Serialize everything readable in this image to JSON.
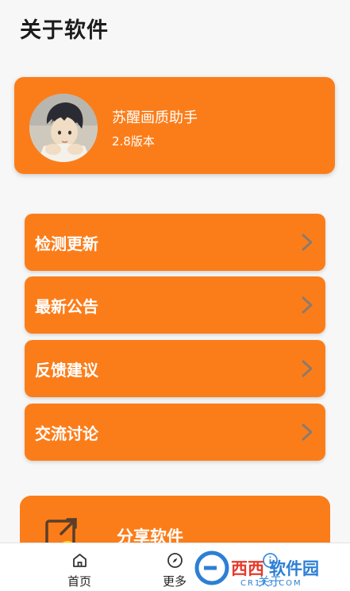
{
  "header": {
    "title": "关于软件"
  },
  "app": {
    "name": "苏醒画质助手",
    "version": "2.8版本"
  },
  "menu": [
    {
      "label": "检测更新"
    },
    {
      "label": "最新公告"
    },
    {
      "label": "反馈建议"
    },
    {
      "label": "交流讨论"
    }
  ],
  "share": {
    "label": "分享软件"
  },
  "nav": [
    {
      "label": "首页",
      "icon": "home-icon"
    },
    {
      "label": "更多",
      "icon": "compass-icon"
    },
    {
      "label": "关于",
      "icon": "info-icon"
    }
  ],
  "watermark": {
    "text": "西西软件园",
    "subtext": "CR173.COM"
  },
  "colors": {
    "accent": "#fb7d1a",
    "background": "#f7f7f7",
    "nav_background": "#ffffff"
  }
}
